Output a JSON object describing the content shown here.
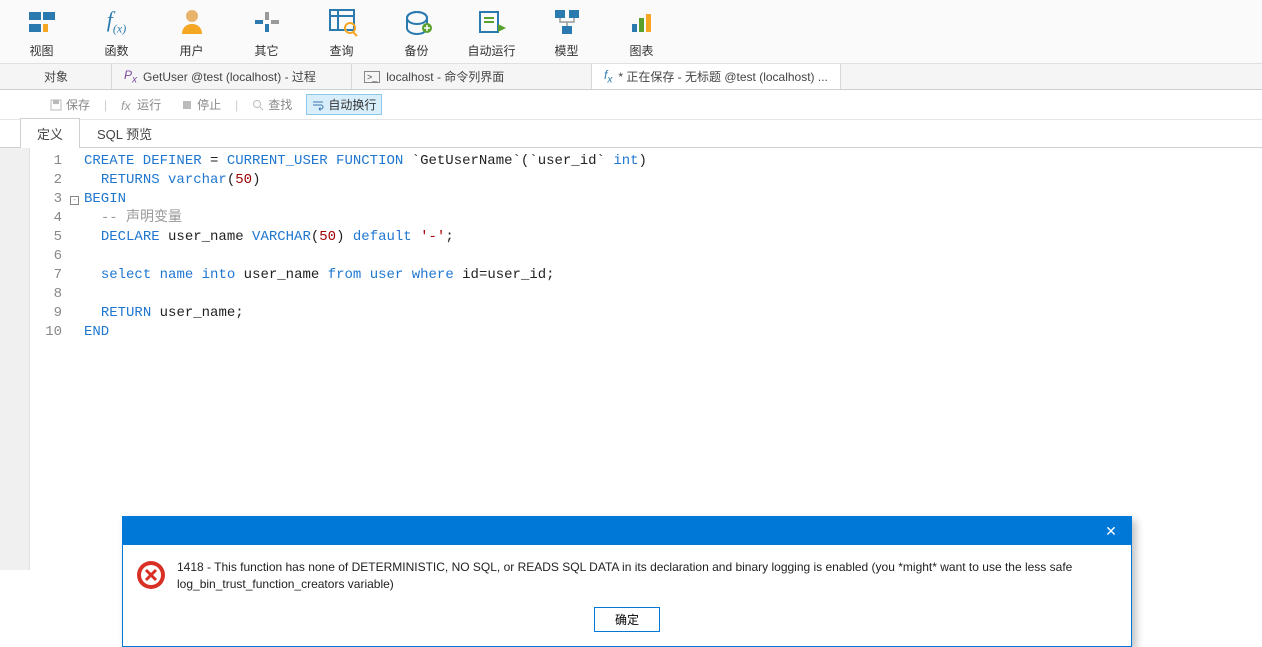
{
  "ribbon": [
    {
      "name": "view",
      "label": "视图",
      "icon": "view-icon"
    },
    {
      "name": "func",
      "label": "函数",
      "icon": "function-icon"
    },
    {
      "name": "user",
      "label": "用户",
      "icon": "user-icon"
    },
    {
      "name": "other",
      "label": "其它",
      "icon": "other-icon"
    },
    {
      "name": "query",
      "label": "查询",
      "icon": "query-icon"
    },
    {
      "name": "backup",
      "label": "备份",
      "icon": "backup-icon"
    },
    {
      "name": "auto",
      "label": "自动运行",
      "icon": "auto-icon"
    },
    {
      "name": "model",
      "label": "模型",
      "icon": "model-icon"
    },
    {
      "name": "chart",
      "label": "图表",
      "icon": "chart-icon"
    }
  ],
  "tabs": [
    {
      "name": "objects",
      "label": "对象",
      "icon": "",
      "active": false
    },
    {
      "name": "getuser",
      "label": "GetUser @test (localhost) - 过程",
      "icon": "Px",
      "active": false
    },
    {
      "name": "cmd",
      "label": "localhost - 命令列界面",
      "icon": ">_",
      "active": false
    },
    {
      "name": "saving",
      "label": "* 正在保存 - 无标题 @test (localhost) ...",
      "icon": "fx",
      "active": true
    }
  ],
  "subbar": {
    "save": "保存",
    "run": "运行",
    "stop": "停止",
    "find": "查找",
    "wrap": "自动换行"
  },
  "secondary_tabs": {
    "definition": "定义",
    "sql_preview": "SQL 预览"
  },
  "code_lines": [
    {
      "n": "1",
      "fold": "",
      "tokens": [
        [
          "kw",
          "CREATE DEFINER"
        ],
        [
          "id",
          " = "
        ],
        [
          "kw",
          "CURRENT_USER FUNCTION"
        ],
        [
          "id",
          " `GetUserName`(`user_id` "
        ],
        [
          "kw",
          "int"
        ],
        [
          "id",
          ")"
        ]
      ]
    },
    {
      "n": "2",
      "fold": "",
      "tokens": [
        [
          "id",
          "  "
        ],
        [
          "kw",
          "RETURNS varchar"
        ],
        [
          "id",
          "("
        ],
        [
          "num",
          "50"
        ],
        [
          "id",
          ")"
        ]
      ]
    },
    {
      "n": "3",
      "fold": "-",
      "tokens": [
        [
          "kw",
          "BEGIN"
        ]
      ]
    },
    {
      "n": "4",
      "fold": "",
      "tokens": [
        [
          "id",
          "  "
        ],
        [
          "cm",
          "-- 声明变量"
        ]
      ]
    },
    {
      "n": "5",
      "fold": "",
      "tokens": [
        [
          "id",
          "  "
        ],
        [
          "kw",
          "DECLARE"
        ],
        [
          "id",
          " user_name "
        ],
        [
          "kw",
          "VARCHAR"
        ],
        [
          "id",
          "("
        ],
        [
          "num",
          "50"
        ],
        [
          "id",
          ") "
        ],
        [
          "kw",
          "default"
        ],
        [
          "id",
          " "
        ],
        [
          "str",
          "'-'"
        ],
        [
          "id",
          ";"
        ]
      ]
    },
    {
      "n": "6",
      "fold": "",
      "tokens": []
    },
    {
      "n": "7",
      "fold": "",
      "tokens": [
        [
          "id",
          "  "
        ],
        [
          "kw",
          "select"
        ],
        [
          "id",
          " "
        ],
        [
          "kw",
          "name"
        ],
        [
          "id",
          " "
        ],
        [
          "kw",
          "into"
        ],
        [
          "id",
          " user_name "
        ],
        [
          "kw",
          "from"
        ],
        [
          "id",
          " "
        ],
        [
          "kw",
          "user"
        ],
        [
          "id",
          " "
        ],
        [
          "kw",
          "where"
        ],
        [
          "id",
          " id=user_id;"
        ]
      ]
    },
    {
      "n": "8",
      "fold": "",
      "tokens": []
    },
    {
      "n": "9",
      "fold": "",
      "tokens": [
        [
          "id",
          "  "
        ],
        [
          "kw",
          "RETURN"
        ],
        [
          "id",
          " user_name;"
        ]
      ]
    },
    {
      "n": "10",
      "fold": "",
      "tokens": [
        [
          "kw",
          "END"
        ]
      ]
    }
  ],
  "dialog": {
    "message": "1418 - This function has none of DETERMINISTIC, NO SQL, or READS SQL DATA in its declaration and binary logging is enabled (you *might* want to use the less safe log_bin_trust_function_creators variable)",
    "ok": "确定"
  }
}
